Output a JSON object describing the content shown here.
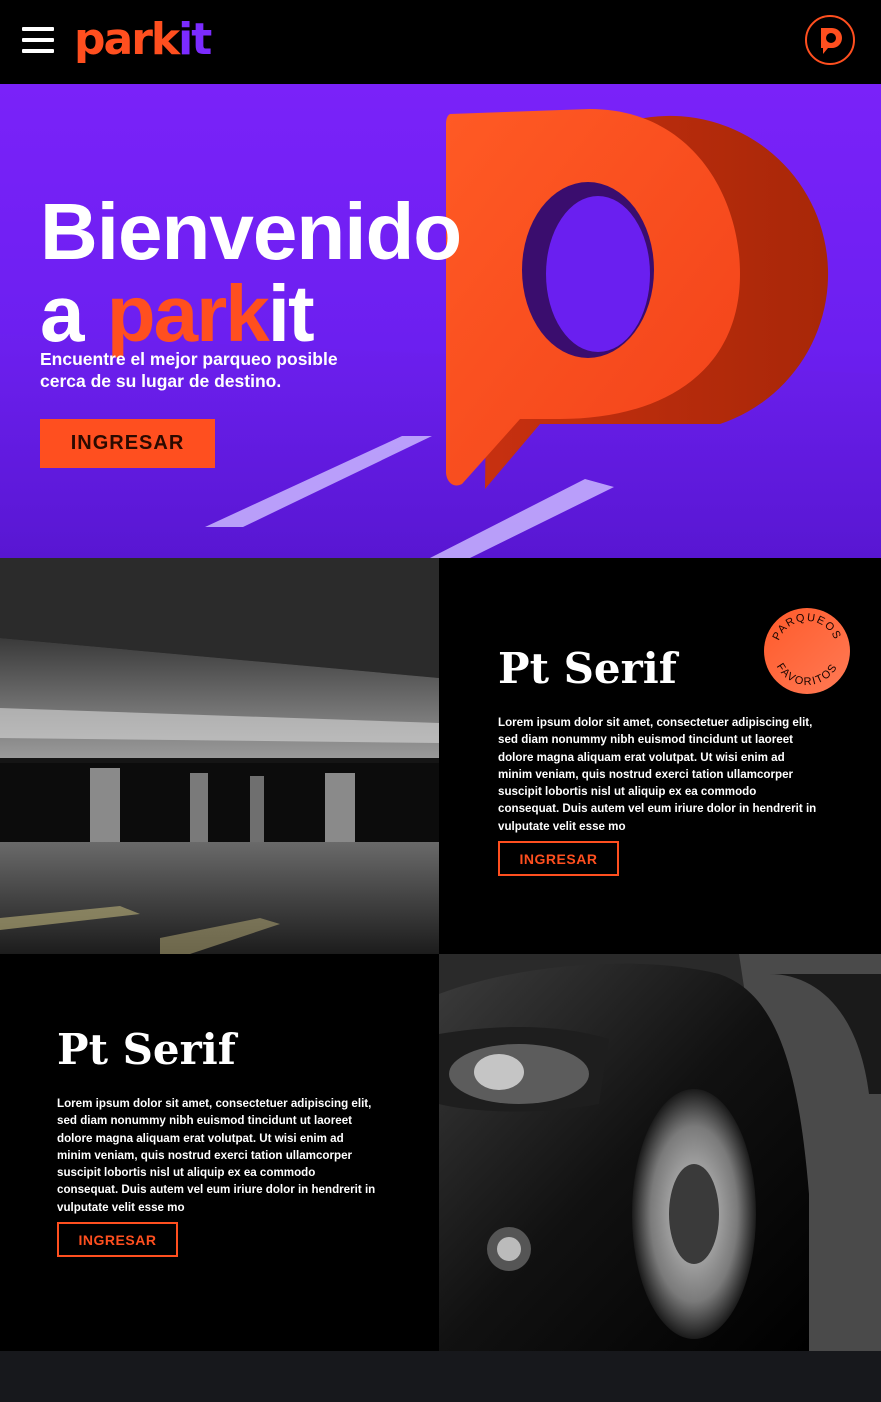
{
  "header": {
    "logo_park": "park",
    "logo_it": "it",
    "badge_icon": "p-logo-icon"
  },
  "hero": {
    "title_line1": "Bienvenido",
    "title_line2_prefix": "a",
    "title_park": "park",
    "title_it": "it",
    "subtitle": "Encuentre el mejor parqueo posible cerca de su lugar de destino.",
    "button_label": "INGRESAR"
  },
  "section1": {
    "title": "Pt Serif",
    "body": "Lorem ipsum dolor sit amet, consectetuer adipiscing elit, sed diam nonummy nibh euismod tincidunt ut laoreet dolore magna aliquam erat volutpat. Ut wisi enim ad minim veniam, quis nostrud exerci tation ullamcorper suscipit lobortis nisl ut aliquip ex ea commodo consequat. Duis autem vel eum iriure dolor in hendrerit in vulputate velit esse mo",
    "button_label": "INGRESAR",
    "badge_top": "PARQUEOS",
    "badge_bottom": "FAVORITOS"
  },
  "section2": {
    "title": "Pt Serif",
    "body": "Lorem ipsum dolor sit amet, consectetuer adipiscing elit, sed diam nonummy nibh euismod tincidunt ut laoreet dolore magna aliquam erat volutpat. Ut wisi enim ad minim veniam, quis nostrud exerci tation ullamcorper suscipit lobortis nisl ut aliquip ex ea commodo consequat. Duis autem vel eum iriure dolor in hendrerit in vulputate velit esse mo",
    "button_label": "INGRESAR"
  },
  "colors": {
    "brand_orange": "#ff4f1f",
    "brand_purple": "#7b2bff",
    "background": "#000000"
  }
}
